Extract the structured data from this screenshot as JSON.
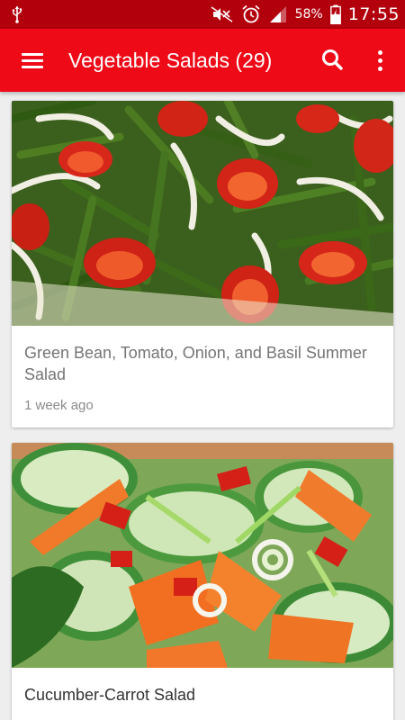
{
  "status_bar": {
    "battery_percent": "58%",
    "time": "17:55"
  },
  "toolbar": {
    "title": "Vegetable Salads (29)"
  },
  "recipes": [
    {
      "title": "Green Bean, Tomato, Onion, and Basil Summer Salad",
      "time_ago": "1 week ago"
    },
    {
      "title": "Cucumber-Carrot Salad"
    }
  ],
  "colors": {
    "status_bar": "#b3000d",
    "toolbar": "#ee0a17",
    "background": "#eeeeee"
  }
}
